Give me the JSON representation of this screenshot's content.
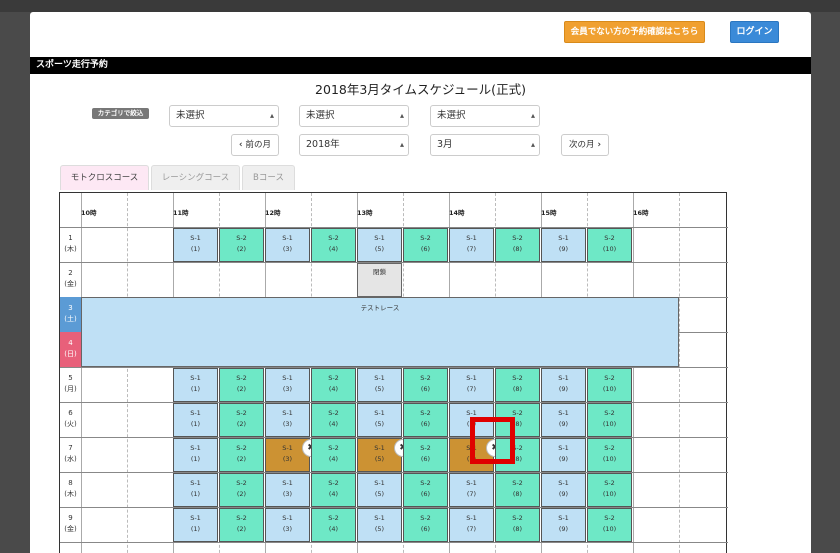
{
  "header": {
    "non_member_button": "会員でない方の予約確認はこちら",
    "login_button": "ログイン"
  },
  "section_title": "スポーツ走行予約",
  "page_title": "2018年3月タイムスケジュール(正式)",
  "filters": {
    "category_badge": "カテゴリで絞込",
    "select1": "未選択",
    "select2": "未選択",
    "select3": "未選択",
    "prev_month": "前の月",
    "year": "2018年",
    "month": "3月",
    "next_month": "次の月"
  },
  "tabs": [
    "モトクロスコース",
    "レーシングコース",
    "Bコース"
  ],
  "hours": [
    "10時",
    "11時",
    "12時",
    "13時",
    "14時",
    "15時",
    "16時"
  ],
  "days": [
    {
      "num": "1",
      "dow": "(木)"
    },
    {
      "num": "2",
      "dow": "(金)"
    },
    {
      "num": "3",
      "dow": "(土)"
    },
    {
      "num": "4",
      "dow": "(日)"
    },
    {
      "num": "5",
      "dow": "(月)"
    },
    {
      "num": "6",
      "dow": "(火)"
    },
    {
      "num": "7",
      "dow": "(水)"
    },
    {
      "num": "8",
      "dow": "(木)"
    },
    {
      "num": "9",
      "dow": "(金)"
    }
  ],
  "slots": [
    {
      "label": "S-1",
      "num": "(1)"
    },
    {
      "label": "S-2",
      "num": "(2)"
    },
    {
      "label": "S-1",
      "num": "(3)"
    },
    {
      "label": "S-2",
      "num": "(4)"
    },
    {
      "label": "S-1",
      "num": "(5)"
    },
    {
      "label": "S-2",
      "num": "(6)"
    },
    {
      "label": "S-1",
      "num": "(7)"
    },
    {
      "label": "S-2",
      "num": "(8)"
    },
    {
      "label": "S-1",
      "num": "(9)"
    },
    {
      "label": "S-2",
      "num": "(10)"
    }
  ],
  "closed_label": "閉鎖",
  "event_label": "テストレース",
  "delete_icon_glyph": "✖",
  "colors": {
    "s1": "#bfe0f5",
    "s2": "#6ee8c6",
    "booked": "#cc9233",
    "highlight": "#e00000"
  }
}
